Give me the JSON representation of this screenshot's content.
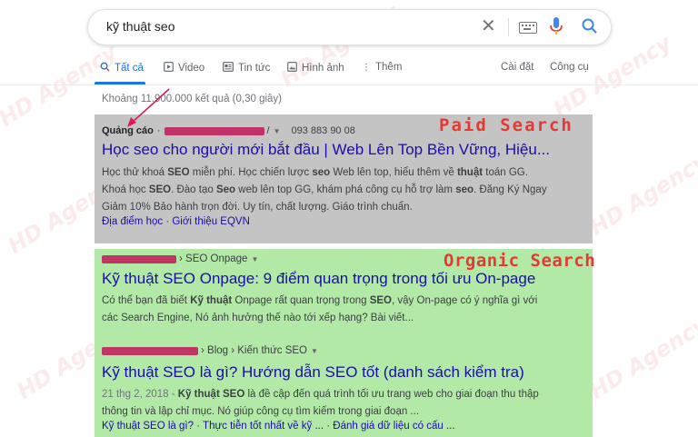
{
  "search": {
    "query": "kỹ thuật seo"
  },
  "tabs": [
    {
      "label": "Tất cả",
      "icon": "search-icon",
      "active": true
    },
    {
      "label": "Video",
      "icon": "video-icon"
    },
    {
      "label": "Tin tức",
      "icon": "news-icon"
    },
    {
      "label": "Hình ảnh",
      "icon": "image-icon"
    },
    {
      "label": "Thêm",
      "icon": "more-vert-icon"
    }
  ],
  "tools": {
    "settings_label": "Cài đặt",
    "tools_label": "Công cụ"
  },
  "result_stats": "Khoảng 11.900.000 kết quả (0,30 giây)",
  "annotations": {
    "paid_label": "Paid Search",
    "organic_label": "Organic Search",
    "watermark": "HD Agency"
  },
  "ad": {
    "badge": "Quảng cáo",
    "phone": "093 883 90 08",
    "title": "Học seo cho người mới bắt đầu | Web Lên Top Bền Vững, Hiệu...",
    "snippet_lines": [
      "Học thử khoá SEO miễn phí. Học chiến lược seo Web lên top, hiểu thêm về thuật toán GG.",
      "Khoá học SEO. Đào tạo Seo web lên top GG, khám phá công cụ hỗ trợ làm seo. Đăng Ký Ngay",
      "Giảm 10% Bảo hành trọn đời. Uy tín, chất lượng. Giáo trình chuẩn."
    ],
    "sitelinks": [
      "Địa điểm học",
      "Giới thiệu EQVN"
    ]
  },
  "organic": [
    {
      "breadcrumb": "› SEO Onpage",
      "title": "Kỹ thuật SEO Onpage: 9 điểm quan trọng trong tối ưu On-page",
      "snippet_lines": [
        "Có thể bạn đã biết Kỹ thuật Onpage rất quan trọng trong SEO, vậy On-page có ý nghĩa gì với",
        "các Search Engine, Nó ảnh hưởng thế nào tới xếp hạng? Bài viết..."
      ]
    },
    {
      "breadcrumb": "› Blog › Kiến thức SEO",
      "title": "Kỹ thuật SEO là gì? Hướng dẫn SEO tốt (danh sách kiểm tra)",
      "date": "21 thg 2, 2018",
      "snippet_lines": [
        "Kỹ thuật SEO là đề cập đến quá trình tối ưu trang web cho giai đoạn thu thập",
        "thông tin và lập chỉ mục. Nó giúp công cụ tìm kiếm trong giai đoạn ..."
      ],
      "sitelinks": [
        "Kỹ thuật SEO là gì?",
        "Thực tiễn tốt nhất về kỹ ...",
        "Đánh giá dữ liệu có cấu ..."
      ]
    }
  ],
  "colors": {
    "paid_bg": "#c4c4c4",
    "organic_bg": "#b3e9a6",
    "label_red": "#e53935",
    "link_blue": "#1a0dab",
    "accent_blue": "#1a73e8"
  }
}
